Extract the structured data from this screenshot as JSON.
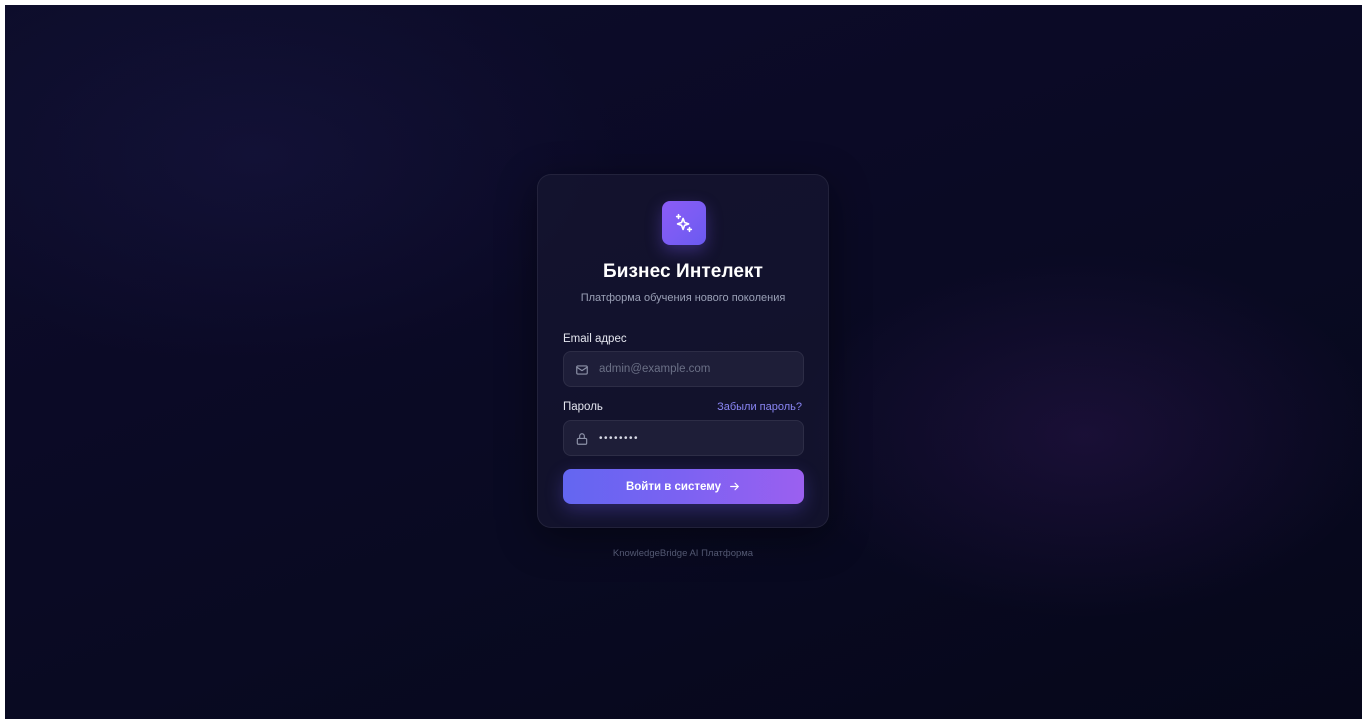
{
  "app": {
    "title": "Бизнес Интелект",
    "subtitle": "Платформа обучения нового поколения",
    "logo_icon": "sparkles-icon"
  },
  "form": {
    "email": {
      "label": "Email адрес",
      "placeholder": "admin@example.com",
      "value": "",
      "icon": "mail-icon"
    },
    "password": {
      "label": "Пароль",
      "value": "••••••••",
      "icon": "lock-icon"
    },
    "forgot_link": "Забыли пароль?",
    "submit_label": "Войти в систему",
    "submit_icon": "arrow-right-icon"
  },
  "footer": {
    "text": "KnowledgeBridge AI Платформа"
  },
  "colors": {
    "accent_start": "#6366f1",
    "accent_end": "#9b60f0",
    "link": "#8a86f5",
    "background": "#0b0a26"
  }
}
